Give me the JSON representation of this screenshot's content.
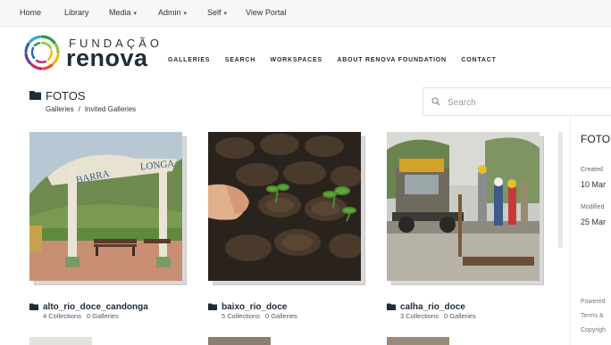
{
  "admin_bar": {
    "home": "Home",
    "library": "Library",
    "media": "Media",
    "admin": "Admin",
    "self": "Self",
    "view_portal": "View Portal"
  },
  "brand": {
    "top": "FUNDAÇÃO",
    "main": "renova",
    "colors": [
      "#2f9a45",
      "#8cc63f",
      "#f7b31b",
      "#e8542e",
      "#c6286d",
      "#6a3d94",
      "#2a66b0",
      "#28a8d8"
    ]
  },
  "nav": [
    "GALLERIES",
    "SEARCH",
    "WORKSPACES",
    "ABOUT RENOVA FOUNDATION",
    "CONTACT"
  ],
  "page": {
    "title": "FOTOS",
    "breadcrumb": [
      "Galleries",
      "Invited Galleries"
    ],
    "breadcrumb_sep": "/"
  },
  "search": {
    "placeholder": "Search"
  },
  "galleries": [
    {
      "name": "alto_rio_doce_candonga",
      "collections": "4 Collections",
      "galleries": "0 Galleries"
    },
    {
      "name": "baixo_rio_doce",
      "collections": "5 Collections",
      "galleries": "0 Galleries"
    },
    {
      "name": "calha_rio_doce",
      "collections": "3 Collections",
      "galleries": "0 Galleries"
    }
  ],
  "sign_text": {
    "left": "BARRA",
    "right": "LONGA"
  },
  "panel": {
    "title": "FOTO",
    "created_label": "Created",
    "created_value": "10 Mar",
    "modified_label": "Modified",
    "modified_value": "25 Mar",
    "footer": [
      "Powered",
      "Terms &",
      "Copyrigh"
    ]
  }
}
